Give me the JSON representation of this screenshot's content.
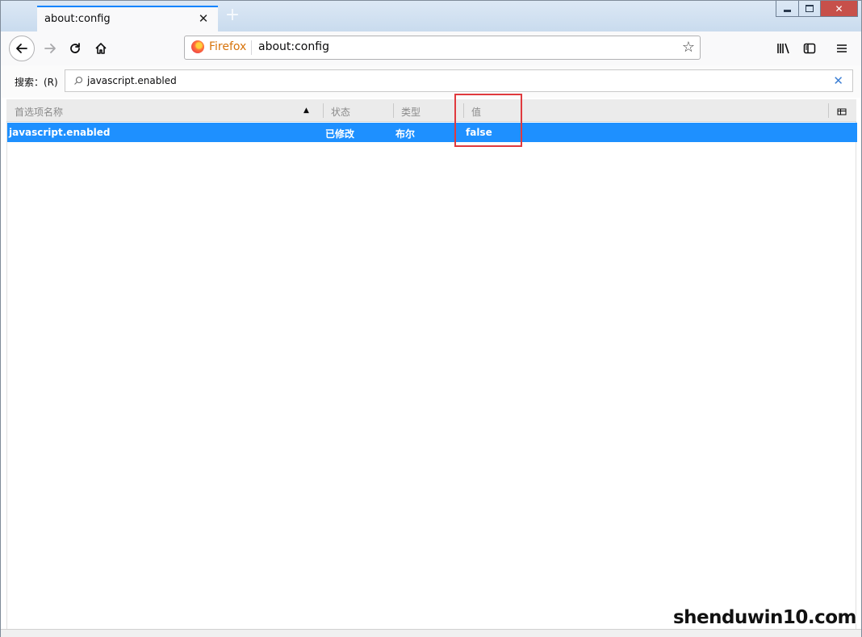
{
  "tab": {
    "title": "about:config",
    "close": "✕",
    "new_tab": "+"
  },
  "window_controls": {
    "minimize": "▁",
    "maximize": "□",
    "close": "✕"
  },
  "navbar": {
    "identity_label": "Firefox",
    "url": "about:config"
  },
  "search": {
    "label": "搜索：(R)",
    "value": "javascript.enabled",
    "clear": "✕"
  },
  "columns": {
    "name": "首选项名称",
    "status": "状态",
    "type": "类型",
    "value": "值",
    "sort_indicator": "▲"
  },
  "rows": [
    {
      "name": "javascript.enabled",
      "status": "已修改",
      "type": "布尔",
      "value": "false",
      "selected": true
    }
  ],
  "colors": {
    "selection": "#1e90ff",
    "tab_accent": "#0a84ff",
    "annotation": "#e03a3e"
  },
  "watermark": "shenduwin10.com"
}
